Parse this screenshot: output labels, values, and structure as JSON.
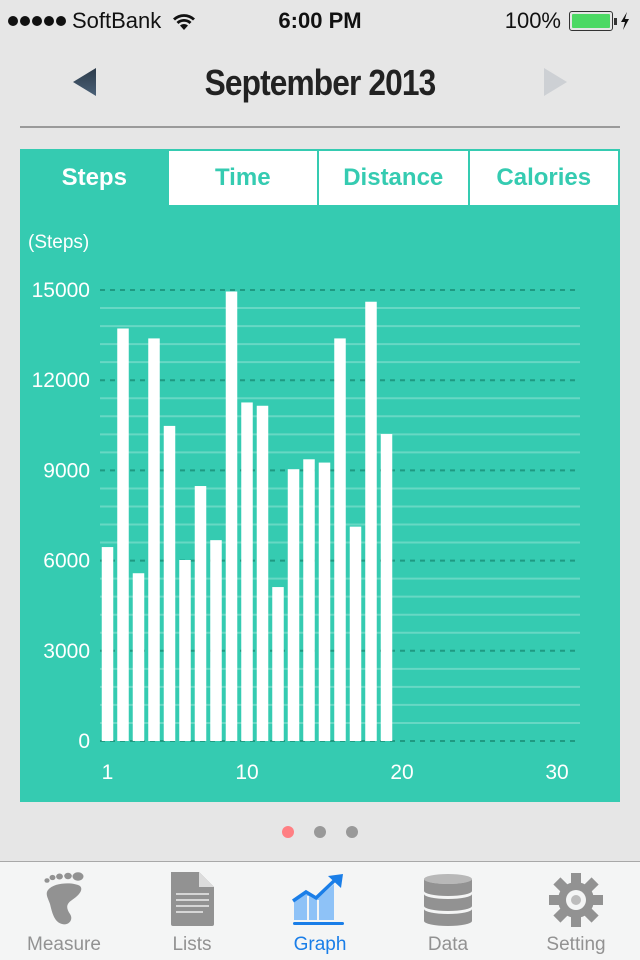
{
  "status_bar": {
    "carrier": "SoftBank",
    "signal_bars": 5,
    "time": "6:00 PM",
    "battery_percent": "100%",
    "battery_color": "#4cd964",
    "charging": true
  },
  "header": {
    "title": "September 2013",
    "prev_icon": "left-triangle-icon",
    "next_icon": "right-triangle-icon"
  },
  "metric_tabs": [
    {
      "label": "Steps",
      "active": true
    },
    {
      "label": "Time",
      "active": false
    },
    {
      "label": "Distance",
      "active": false
    },
    {
      "label": "Calories",
      "active": false
    }
  ],
  "colors": {
    "accent": "#35cbb1",
    "bar": "#ffffff",
    "active_dot": "#ff7f83",
    "inactive_dot": "#999999",
    "tabbar_selected": "#1a7ee8",
    "tabbar_unselected": "#929292"
  },
  "chart_data": {
    "type": "bar",
    "title": "",
    "xlabel": "",
    "ylabel": "(Steps)",
    "x": [
      1,
      2,
      3,
      4,
      5,
      6,
      7,
      8,
      9,
      10,
      11,
      12,
      13,
      14,
      15,
      16,
      17,
      18,
      19
    ],
    "values": [
      6450,
      13720,
      5580,
      13390,
      10480,
      6020,
      8480,
      6680,
      14950,
      11260,
      11150,
      5120,
      9040,
      9370,
      9260,
      13390,
      7130,
      14610,
      10210
    ],
    "xlim": [
      1,
      30
    ],
    "ylim": [
      0,
      15000
    ],
    "x_ticks": [
      "1",
      "10",
      "20",
      "30"
    ],
    "x_tick_values": [
      1,
      10,
      20,
      30
    ],
    "y_ticks": [
      "0",
      "3000",
      "6000",
      "9000",
      "12000",
      "15000"
    ],
    "y_tick_values": [
      0,
      3000,
      6000,
      9000,
      12000,
      15000
    ],
    "minor_grid_step": 600,
    "grid": true,
    "legend": "none"
  },
  "page_indicator": {
    "count": 3,
    "active_index": 0
  },
  "tabbar": {
    "items": [
      {
        "label": "Measure",
        "icon": "footprint-icon",
        "selected": false
      },
      {
        "label": "Lists",
        "icon": "document-icon",
        "selected": false
      },
      {
        "label": "Graph",
        "icon": "graph-icon",
        "selected": true
      },
      {
        "label": "Data",
        "icon": "database-icon",
        "selected": false
      },
      {
        "label": "Setting",
        "icon": "gear-icon",
        "selected": false
      }
    ]
  }
}
